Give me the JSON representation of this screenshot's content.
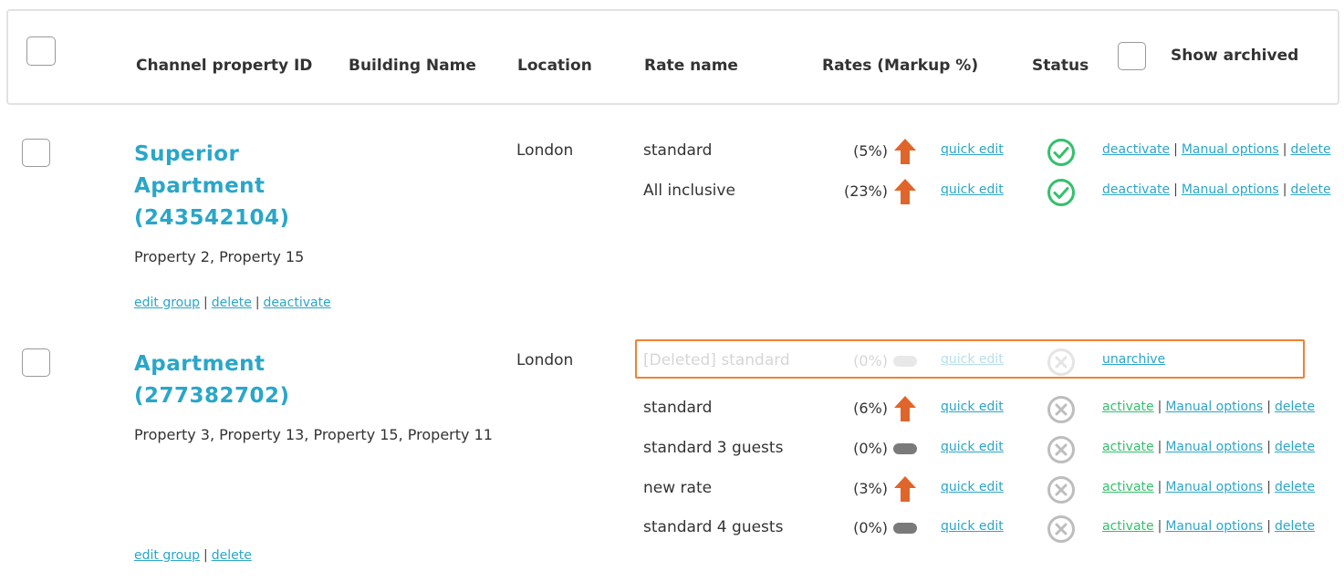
{
  "header": {
    "col_id": "Channel property ID",
    "col_building": "Building Name",
    "col_location": "Location",
    "col_rate": "Rate name",
    "col_rates": "Rates (Markup %)",
    "col_status": "Status",
    "show_archived": "Show archived"
  },
  "colors": {
    "accent": "#2aa6c8",
    "up_arrow": "#e0652b",
    "active": "#33c06c",
    "inactive": "#bdbdbd",
    "highlight": "#ef8233"
  },
  "properties": [
    {
      "title_line1": "Superior",
      "title_line2": "Apartment",
      "title_line3": "(243542104)",
      "subtitle": "Property 2, Property 15",
      "location": "London",
      "links": {
        "edit_group": "edit group",
        "delete": "delete",
        "deactivate": "deactivate"
      },
      "rates": [
        {
          "name": "standard",
          "markup": "(5%)",
          "trend": "up-arrow-icon",
          "quick_edit": "quick edit",
          "status": "active",
          "actions": {
            "toggle": "deactivate",
            "manual": "Manual options",
            "delete": "delete"
          }
        },
        {
          "name": "All inclusive",
          "markup": "(23%)",
          "trend": "up-arrow-icon",
          "quick_edit": "quick edit",
          "status": "active",
          "actions": {
            "toggle": "deactivate",
            "manual": "Manual options",
            "delete": "delete"
          }
        }
      ]
    },
    {
      "title_line1": "Apartment",
      "title_line2": "(277382702)",
      "subtitle": "Property 3, Property 13, Property 15, Property 11",
      "location": "London",
      "links": {
        "edit_group": "edit group",
        "delete": "delete"
      },
      "rates": [
        {
          "name": "[Deleted] standard",
          "markup": "(0%)",
          "trend": "neutral-pill-icon",
          "quick_edit": "quick edit",
          "status": "deleted",
          "actions": {
            "unarchive": "unarchive"
          }
        },
        {
          "name": "standard",
          "markup": "(6%)",
          "trend": "up-arrow-icon",
          "quick_edit": "quick edit",
          "status": "inactive",
          "actions": {
            "toggle": "activate",
            "manual": "Manual options",
            "delete": "delete"
          }
        },
        {
          "name": "standard 3 guests",
          "markup": "(0%)",
          "trend": "neutral-pill-icon",
          "quick_edit": "quick edit",
          "status": "inactive",
          "actions": {
            "toggle": "activate",
            "manual": "Manual options",
            "delete": "delete"
          }
        },
        {
          "name": "new rate",
          "markup": "(3%)",
          "trend": "up-arrow-icon",
          "quick_edit": "quick edit",
          "status": "inactive",
          "actions": {
            "toggle": "activate",
            "manual": "Manual options",
            "delete": "delete"
          }
        },
        {
          "name": "standard 4 guests",
          "markup": "(0%)",
          "trend": "neutral-pill-icon",
          "quick_edit": "quick edit",
          "status": "inactive",
          "actions": {
            "toggle": "activate",
            "manual": "Manual options",
            "delete": "delete"
          }
        }
      ]
    }
  ]
}
